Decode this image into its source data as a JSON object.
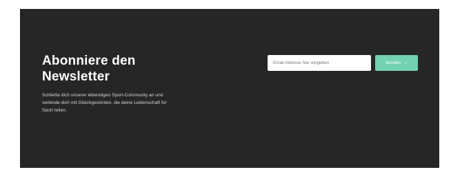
{
  "newsletter": {
    "title": "Abonniere den Newsletter",
    "description": "Schließe dich unserer lebendigen Sport-Community an und verbinde dich mit Gleichgesinnten, die deine Leidenschaft für Sport teilen.",
    "email_value": "",
    "email_placeholder": "Email Adresse hier eingeben",
    "button_label": "Senden",
    "button_icon": "arrow-right-icon",
    "button_icon_glyph": "→"
  },
  "colors": {
    "page_background": "#ffffff",
    "panel_background": "#262626",
    "title_text": "#ffffff",
    "body_text": "#d7d7d7",
    "input_background": "#ffffff",
    "button_background": "#72d2b1",
    "button_text": "#ffffff"
  }
}
